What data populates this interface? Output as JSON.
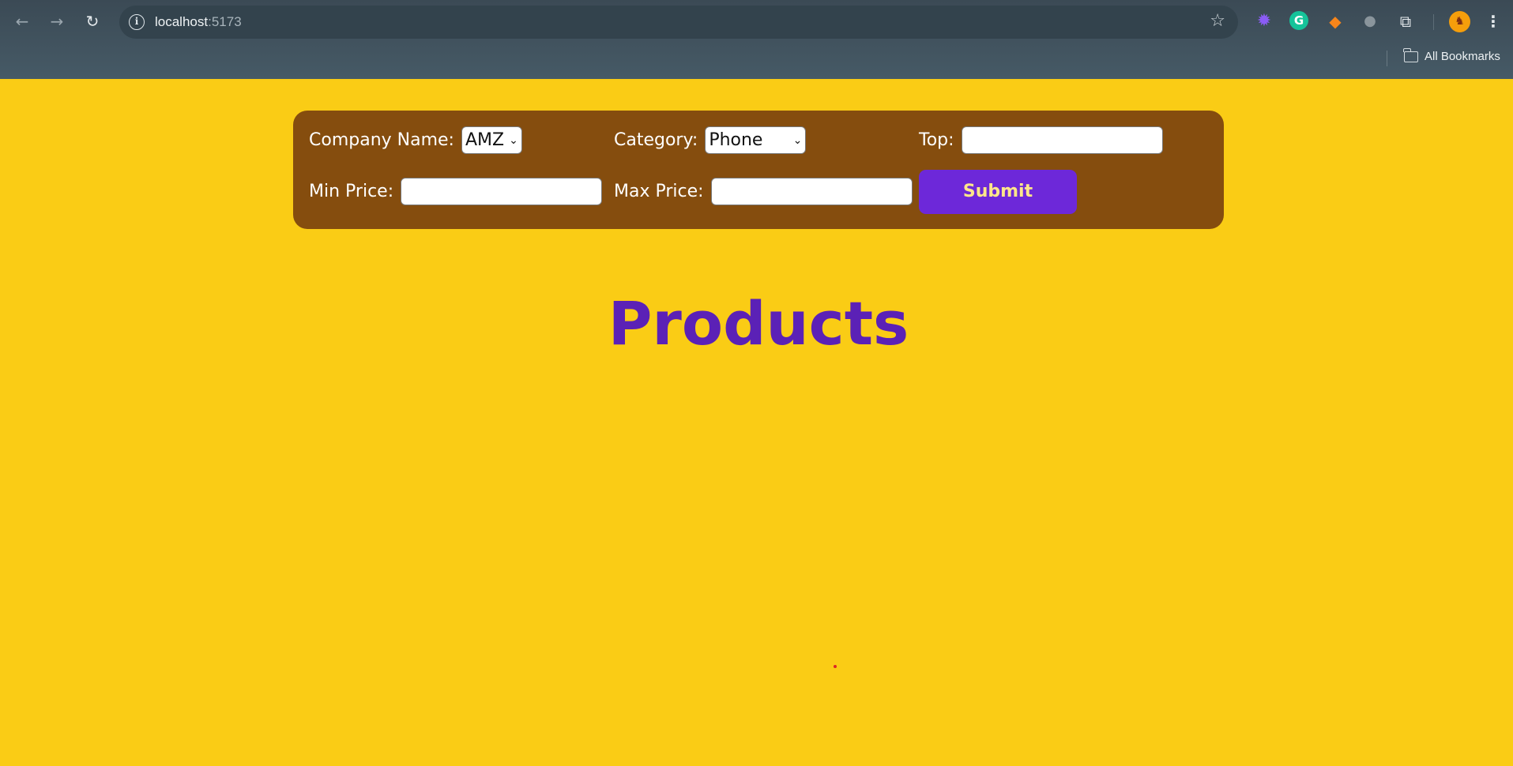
{
  "browser": {
    "url_host": "localhost",
    "url_port": ":5173",
    "bookmarks_label": "All Bookmarks",
    "icons": [
      "back-icon",
      "forward-icon",
      "reload-icon",
      "site-info-icon",
      "bookmark-star-icon",
      "extension-gear-icon",
      "grammarly-icon",
      "metamask-icon",
      "extension-gray-icon",
      "extensions-puzzle-icon",
      "profile-avatar",
      "menu-kebab-icon",
      "folder-icon"
    ]
  },
  "filters": {
    "company_label": "Company Name:",
    "company_value": "AMZ",
    "category_label": "Category:",
    "category_value": "Phone",
    "top_label": "Top:",
    "top_value": "",
    "min_price_label": "Min Price:",
    "min_price_value": "",
    "max_price_label": "Max Price:",
    "max_price_value": "",
    "submit_label": "Submit"
  },
  "main": {
    "title": "Products"
  },
  "colors": {
    "page_bg": "#facc15",
    "panel_bg": "#854d0e",
    "title": "#5b21b6",
    "button_bg": "#6d28d9",
    "button_text": "#fde68a"
  }
}
